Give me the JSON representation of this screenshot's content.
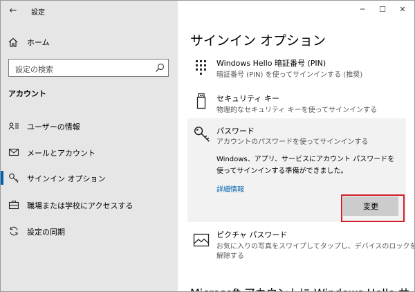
{
  "window": {
    "title": "設定"
  },
  "controls": {
    "back": "←",
    "minimize": "─",
    "maximize": "☐",
    "close": "✕"
  },
  "sidebar": {
    "home_label": "ホーム",
    "search_placeholder": "設定の検索",
    "section_title": "アカウント",
    "items": [
      {
        "label": "ユーザーの情報",
        "icon": "user-info-icon"
      },
      {
        "label": "メールとアカウント",
        "icon": "mail-icon"
      },
      {
        "label": "サインイン オプション",
        "icon": "key-icon",
        "active": true
      },
      {
        "label": "職場または学校にアクセスする",
        "icon": "briefcase-icon"
      },
      {
        "label": "設定の同期",
        "icon": "sync-icon"
      }
    ]
  },
  "main": {
    "title": "サインイン オプション",
    "options": [
      {
        "name": "Windows Hello 暗証番号 (PIN)",
        "desc": "暗証番号 (PIN) を使ってサインインする (推奨)",
        "icon": "pin-keypad-icon"
      },
      {
        "name": "セキュリティ キー",
        "desc": "物理的なセキュリティ キーを使ってサインインする",
        "icon": "usb-key-icon"
      }
    ],
    "password": {
      "name": "パスワード",
      "desc": "アカウントのパスワードを使ってサインインする",
      "body": "Windows、アプリ、サービスにアカウント パスワードを使ってサインインする準備ができました。",
      "link": "詳細情報",
      "button": "変更",
      "icon": "key-icon"
    },
    "picture_password": {
      "name": "ピクチャ パスワード",
      "desc1": "お気に入りの写真をスワイプしてタップし、デバイスのロックを",
      "desc2": "解除する",
      "icon": "picture-icon"
    },
    "bottom_title": "Microsoft アカウントに Windows Hello サイン"
  },
  "colors": {
    "accent": "#0063b1",
    "highlight": "#d21e2b",
    "sidebar_bg": "#e6e6e6",
    "expanded_bg": "#f2f2f2",
    "button_bg": "#cccccc"
  }
}
